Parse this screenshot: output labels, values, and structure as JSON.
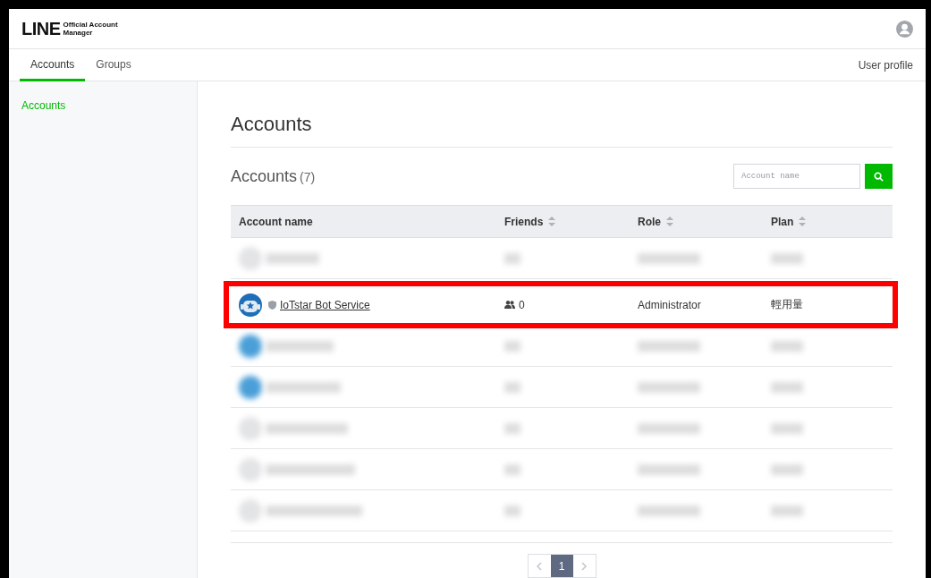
{
  "header": {
    "logo_mark": "LINE",
    "logo_text_line1": "Official Account",
    "logo_text_line2": "Manager"
  },
  "tabs": [
    {
      "label": "Accounts",
      "selected": true
    },
    {
      "label": "Groups",
      "selected": false
    }
  ],
  "user_link": "User profile",
  "sidebar": {
    "items": [
      {
        "label": "Accounts",
        "selected": true
      }
    ]
  },
  "page_title": "Accounts",
  "section": {
    "title": "Accounts",
    "count": "(7)"
  },
  "search": {
    "placeholder": "Account name"
  },
  "table": {
    "columns": [
      {
        "label": "Account name",
        "sortable": false
      },
      {
        "label": "Friends",
        "sortable": true
      },
      {
        "label": "Role",
        "sortable": true
      },
      {
        "label": "Plan",
        "sortable": true
      }
    ],
    "rows": [
      {
        "kind": "blurred",
        "color": "#e3e4e6"
      },
      {
        "kind": "account",
        "name": "IoTstar Bot Service",
        "friends": "0",
        "role": "Administrator",
        "plan": "輕用量",
        "highlighted": true
      },
      {
        "kind": "blurred",
        "color": "#4a9fd8"
      },
      {
        "kind": "blurred",
        "color": "#4a9fd8"
      },
      {
        "kind": "blurred",
        "color": "#e3e4e6"
      },
      {
        "kind": "blurred",
        "color": "#e3e4e6"
      },
      {
        "kind": "blurred",
        "color": "#e3e4e6"
      }
    ]
  },
  "pagination": {
    "pages": [
      {
        "label": "1",
        "selected": true
      }
    ]
  }
}
